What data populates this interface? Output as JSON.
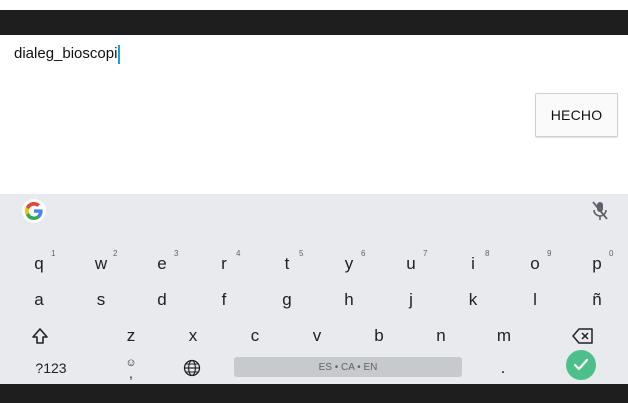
{
  "editor": {
    "text": "dialeg_bioscopi"
  },
  "done_button": {
    "label": "HECHO"
  },
  "keyboard": {
    "accent_color": "#4dbf8a",
    "toolbar": {
      "left_icon": "google-g-icon",
      "right_icon": "mic-off-icon"
    },
    "row1": [
      {
        "key": "q",
        "num": "1"
      },
      {
        "key": "w",
        "num": "2"
      },
      {
        "key": "e",
        "num": "3"
      },
      {
        "key": "r",
        "num": "4"
      },
      {
        "key": "t",
        "num": "5"
      },
      {
        "key": "y",
        "num": "6"
      },
      {
        "key": "u",
        "num": "7"
      },
      {
        "key": "i",
        "num": "8"
      },
      {
        "key": "o",
        "num": "9"
      },
      {
        "key": "p",
        "num": "0"
      }
    ],
    "row2": [
      "a",
      "s",
      "d",
      "f",
      "g",
      "h",
      "j",
      "k",
      "l",
      "ñ"
    ],
    "row3": [
      "z",
      "x",
      "c",
      "v",
      "b",
      "n",
      "m"
    ],
    "row4": {
      "symbols_label": "?123",
      "emoji_comma": ",",
      "space_label": "ES • CA • EN",
      "period": "."
    },
    "icons": {
      "shift": "shift-icon",
      "backspace": "backspace-icon",
      "emoji": "emoji-icon",
      "language": "globe-icon",
      "enter": "check-icon"
    }
  }
}
